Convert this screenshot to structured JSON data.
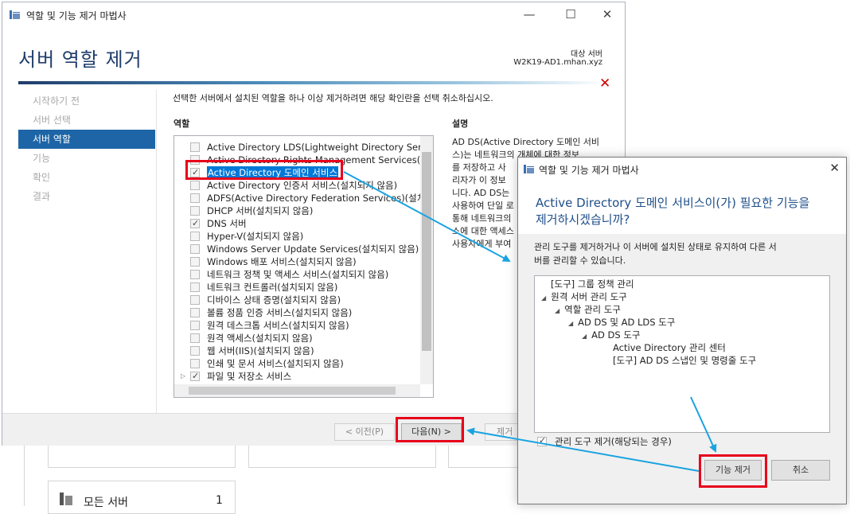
{
  "wizard": {
    "title": "역할 및 기능 제거 마법사",
    "page_title": "서버 역할 제거",
    "target_label": "대상 서버",
    "target_name": "W2K19-AD1.mhan.xyz",
    "nav": [
      "시작하기 전",
      "서버 선택",
      "서버 역할",
      "기능",
      "확인",
      "결과"
    ],
    "instruction": "선택한 서버에서 설치된 역할을 하나 이상 제거하려면 해당 확인란을 선택 취소하십시오.",
    "roles_header": "역할",
    "desc_header": "설명",
    "roles": [
      {
        "label": "Active Directory LDS(Lightweight Directory Services)",
        "checked": false
      },
      {
        "label": "Active Directory Rights Management Services(설치되지 않음)",
        "checked": false
      },
      {
        "label": "Active Directory 도메인 서비스",
        "checked": true
      },
      {
        "label": "Active Directory 인증서 서비스(설치되지 않음)",
        "checked": false
      },
      {
        "label": "ADFS(Active Directory Federation Services)(설치되지 않음)",
        "checked": false
      },
      {
        "label": "DHCP 서버(설치되지 않음)",
        "checked": false
      },
      {
        "label": "DNS 서버",
        "checked": true
      },
      {
        "label": "Hyper-V(설치되지 않음)",
        "checked": false
      },
      {
        "label": "Windows Server Update Services(설치되지 않음)",
        "checked": false
      },
      {
        "label": "Windows 배포 서비스(설치되지 않음)",
        "checked": false
      },
      {
        "label": "네트워크 정책 및 액세스 서비스(설치되지 않음)",
        "checked": false
      },
      {
        "label": "네트워크 컨트롤러(설치되지 않음)",
        "checked": false
      },
      {
        "label": "디바이스 상태 증명(설치되지 않음)",
        "checked": false
      },
      {
        "label": "볼륨 정품 인증 서비스(설치되지 않음)",
        "checked": false
      },
      {
        "label": "원격 데스크톱 서비스(설치되지 않음)",
        "checked": false
      },
      {
        "label": "원격 액세스(설치되지 않음)",
        "checked": false
      },
      {
        "label": "웹 서버(IIS)(설치되지 않음)",
        "checked": false
      },
      {
        "label": "인쇄 및 문서 서비스(설치되지 않음)",
        "checked": false
      },
      {
        "label": "파일 및 저장소 서비스",
        "checked": true
      }
    ],
    "description_lines": [
      "AD DS(Active Directory 도메인 서비",
      "스)는 네트워크의 개체에 대한 정보",
      "를 저장하고 사",
      "리자가 이 정보",
      "니다. AD DS는",
      "사용하여 단일 로",
      "통해 네트워크의",
      "스에 대한 액세스",
      "사용자에게 부여"
    ],
    "buttons": {
      "prev": "< 이전(P)",
      "next": "다음(N) >",
      "remove_partial": "제거"
    }
  },
  "dialog": {
    "title": "역할 및 기능 제거 마법사",
    "heading_lines": [
      "Active Directory 도메인 서비스이(가) 필요한 기능을",
      "제거하시겠습니까?"
    ],
    "desc_lines": [
      "관리 도구를 제거하거나 이 서버에 설치된 상태로 유지하여 다른 서",
      "버를 관리할 수 있습니다."
    ],
    "tree": [
      {
        "label": "[도구] 그룹 정책 관리",
        "level": 0,
        "expander": false
      },
      {
        "label": "원격 서버 관리 도구",
        "level": 0,
        "expander": true
      },
      {
        "label": "역할 관리 도구",
        "level": 1,
        "expander": true
      },
      {
        "label": "AD DS 및 AD LDS 도구",
        "level": 2,
        "expander": true
      },
      {
        "label": "AD DS 도구",
        "level": 3,
        "expander": true
      },
      {
        "label": "Active Directory 관리 센터",
        "level": 4,
        "expander": false
      },
      {
        "label": "[도구] AD DS 스냅인 및 명령줄 도구",
        "level": 4,
        "expander": false
      }
    ],
    "checkbox_label": "관리 도구 제거(해당되는 경우)",
    "checkbox_checked": true,
    "btn_remove": "기능 제거",
    "btn_cancel": "취소"
  },
  "background": {
    "all_servers_label": "모든 서버",
    "all_servers_count": "1"
  },
  "colors": {
    "accent": "#1d65a6",
    "highlight_box": "#e8001c",
    "arrow": "#1aa3e0"
  }
}
